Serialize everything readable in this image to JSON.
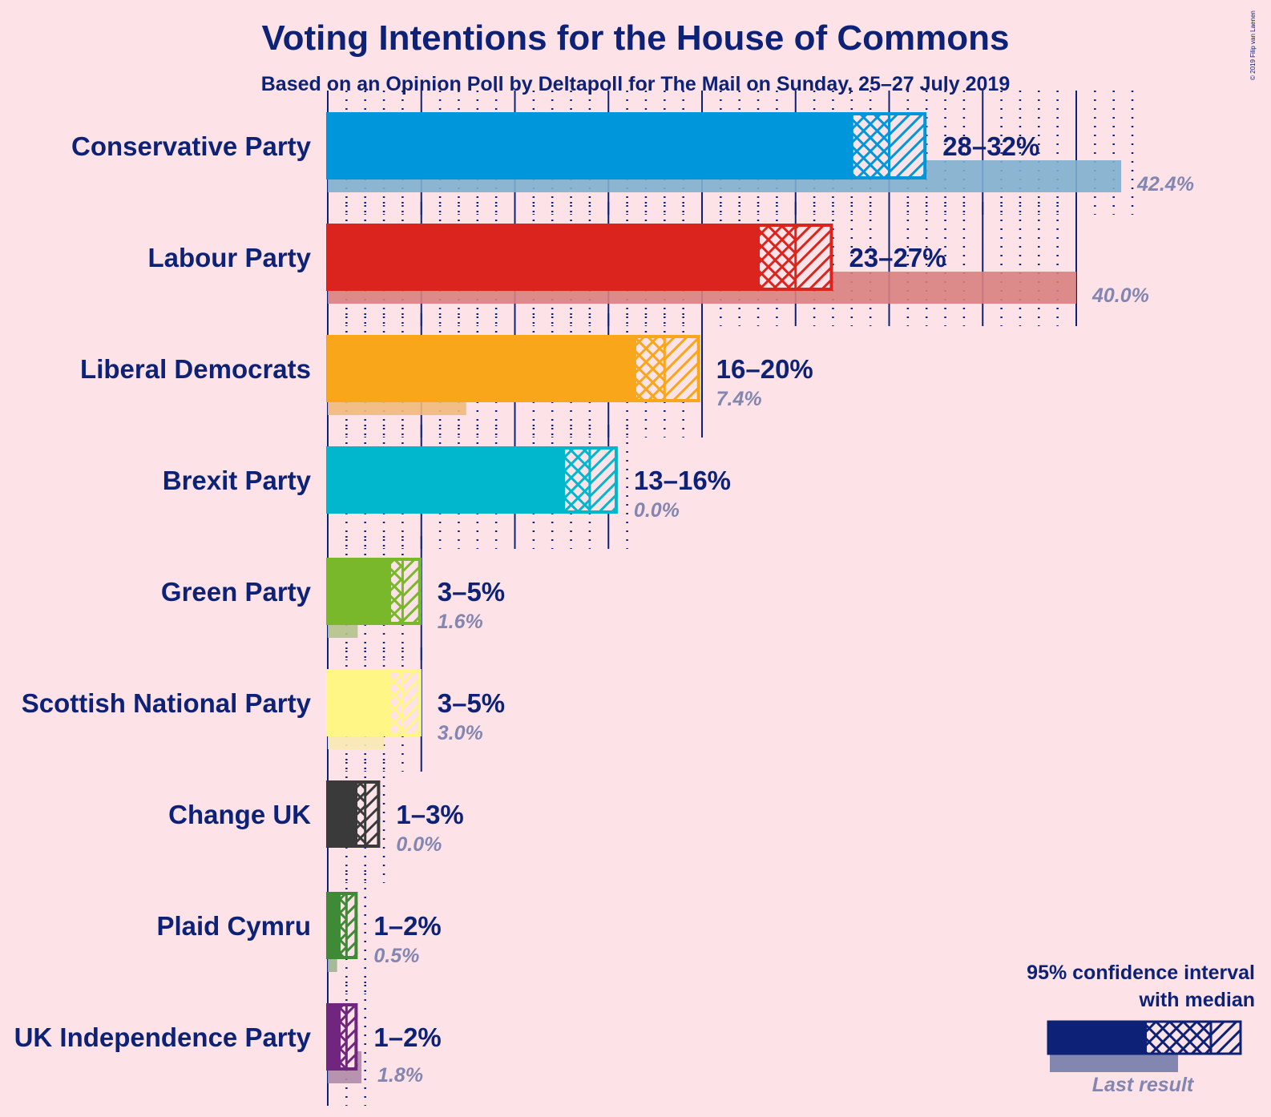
{
  "chart_data": {
    "type": "bar",
    "orientation": "horizontal",
    "title": "Voting Intentions for the House of Commons",
    "subtitle": "Based on an Opinion Poll by Deltapoll for The Mail on Sunday, 25–27 July 2019",
    "copyright": "© 2019 Filip van Laenen",
    "xlabel": "",
    "ylabel": "",
    "xlim": [
      0,
      43
    ],
    "grid": {
      "major_every": 5,
      "minor_every": 1
    },
    "legend": {
      "position": "bottom-right",
      "title_line1": "95% confidence interval",
      "title_line2": "with median",
      "last_result_label": "Last result",
      "color": "#0d2277",
      "last_color": "#8286b0"
    },
    "series": [
      {
        "name": "Conservative Party",
        "color": "#0096db",
        "last_color": "#80afcf",
        "ci_low": 28.0,
        "median": 30.0,
        "ci_high": 32.0,
        "range_label": "28–32%",
        "last_result": 42.4,
        "last_label": "42.4%"
      },
      {
        "name": "Labour Party",
        "color": "#dc241f",
        "last_color": "#d98080",
        "ci_low": 23.0,
        "median": 25.0,
        "ci_high": 27.0,
        "range_label": "23–27%",
        "last_result": 40.0,
        "last_label": "40.0%"
      },
      {
        "name": "Liberal Democrats",
        "color": "#faa61a",
        "last_color": "#f0b97b",
        "ci_low": 16.4,
        "median": 18.0,
        "ci_high": 19.9,
        "range_label": "16–20%",
        "last_result": 7.4,
        "last_label": "7.4%"
      },
      {
        "name": "Brexit Party",
        "color": "#00b7ce",
        "last_color": "#7fc7d2",
        "ci_low": 12.6,
        "median": 14.0,
        "ci_high": 15.5,
        "range_label": "13–16%",
        "last_result": 0.0,
        "last_label": "0.0%"
      },
      {
        "name": "Green Party",
        "color": "#78b82a",
        "last_color": "#b3c289",
        "ci_low": 3.3,
        "median": 4.0,
        "ci_high": 5.0,
        "range_label": "3–5%",
        "last_result": 1.6,
        "last_label": "1.6%"
      },
      {
        "name": "Scottish National Party",
        "color": "#fff685",
        "last_color": "#f9e9b3",
        "ci_low": 3.3,
        "median": 4.0,
        "ci_high": 5.0,
        "range_label": "3–5%",
        "last_result": 3.0,
        "last_label": "3.0%"
      },
      {
        "name": "Change UK",
        "color": "#3a3a3a",
        "last_color": "#9c8f94",
        "ci_low": 1.5,
        "median": 2.0,
        "ci_high": 2.8,
        "range_label": "1–3%",
        "last_result": 0.0,
        "last_label": "0.0%"
      },
      {
        "name": "Plaid Cymru",
        "color": "#3f8a36",
        "last_color": "#9db292",
        "ci_low": 0.6,
        "median": 1.0,
        "ci_high": 1.6,
        "range_label": "1–2%",
        "last_result": 0.5,
        "last_label": "0.5%"
      },
      {
        "name": "UK Independence Party",
        "color": "#70267f",
        "last_color": "#b08aaa",
        "ci_low": 0.6,
        "median": 1.0,
        "ci_high": 1.6,
        "range_label": "1–2%",
        "last_result": 1.8,
        "last_label": "1.8%"
      }
    ]
  }
}
